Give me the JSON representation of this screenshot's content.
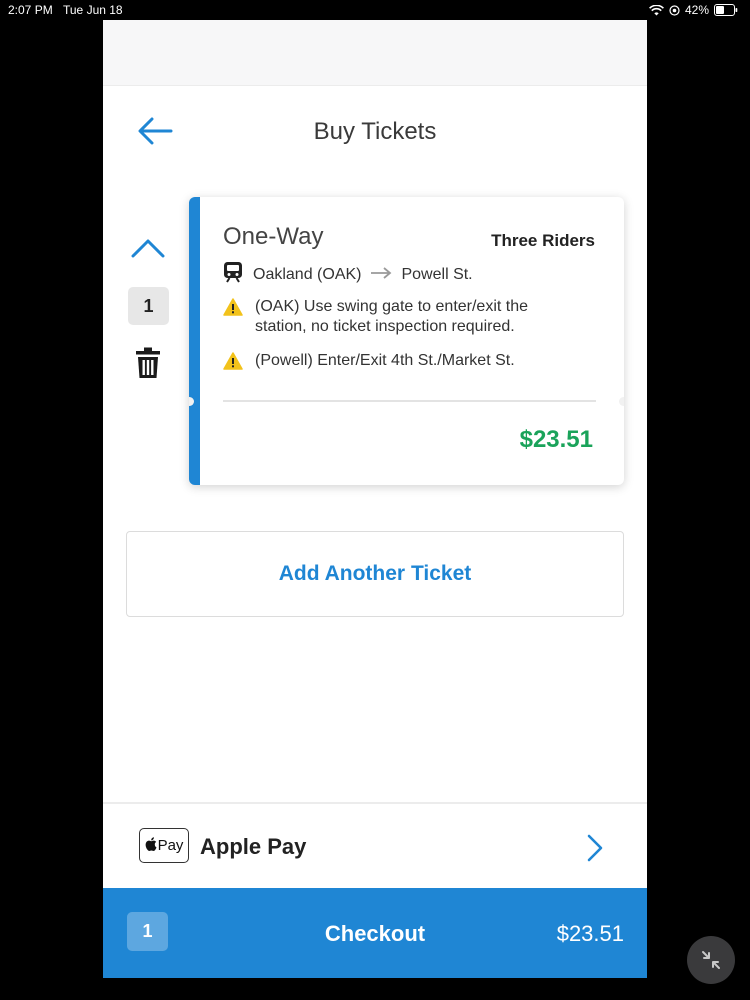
{
  "status_bar": {
    "time": "2:07 PM",
    "date": "Tue Jun 18",
    "battery": "42%",
    "icons": [
      "wifi-icon",
      "location-icon",
      "battery-icon"
    ]
  },
  "header": {
    "title": "Buy Tickets",
    "back_icon": "arrow-left-icon"
  },
  "stepper": {
    "quantity": "1",
    "up_icon": "chevron-up-icon",
    "delete_icon": "trash-icon"
  },
  "ticket": {
    "type": "One-Way",
    "riders": "Three Riders",
    "origin": "Oakland (OAK)",
    "destination": "Powell St.",
    "notices": [
      "(OAK) Use swing gate to enter/exit the station, no ticket inspection required.",
      "(Powell) Enter/Exit 4th St./Market St."
    ],
    "price": "$23.51"
  },
  "add_ticket": {
    "label": "Add Another Ticket"
  },
  "payment": {
    "badge_text": "Pay",
    "label": "Apple Pay"
  },
  "checkout": {
    "count": "1",
    "label": "Checkout",
    "total": "$23.51"
  },
  "colors": {
    "accent": "#1f86d4",
    "price_green": "#1aa35a",
    "warning_yellow": "#f2c21b"
  }
}
